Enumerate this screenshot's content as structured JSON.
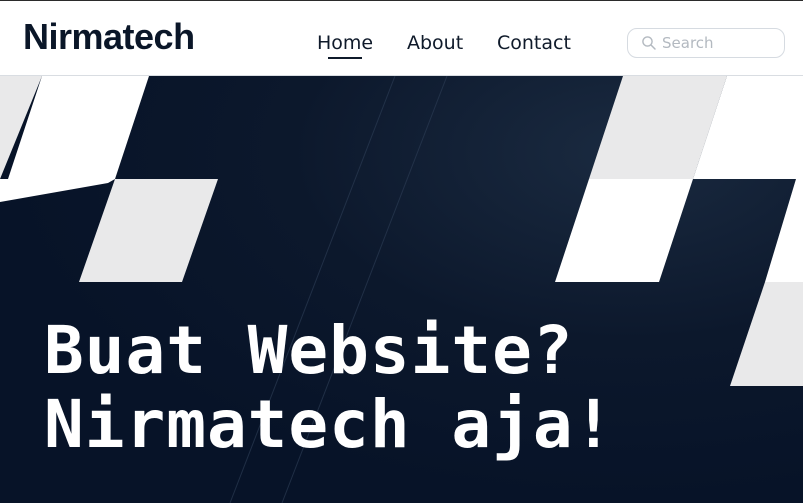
{
  "brand": {
    "name": "Nirmatech"
  },
  "nav": {
    "items": [
      {
        "label": "Home",
        "active": true
      },
      {
        "label": "About",
        "active": false
      },
      {
        "label": "Contact",
        "active": false
      }
    ]
  },
  "search": {
    "placeholder": "Search",
    "value": "",
    "icon": "search-icon"
  },
  "hero": {
    "headline_line1": "Buat Website?",
    "headline_line2": "Nirmatech aja!"
  },
  "colors": {
    "hero_background": "#071328",
    "brand_text": "#0a1628",
    "tile_white": "#ffffff",
    "tile_light_gray": "#e9e9ea"
  }
}
